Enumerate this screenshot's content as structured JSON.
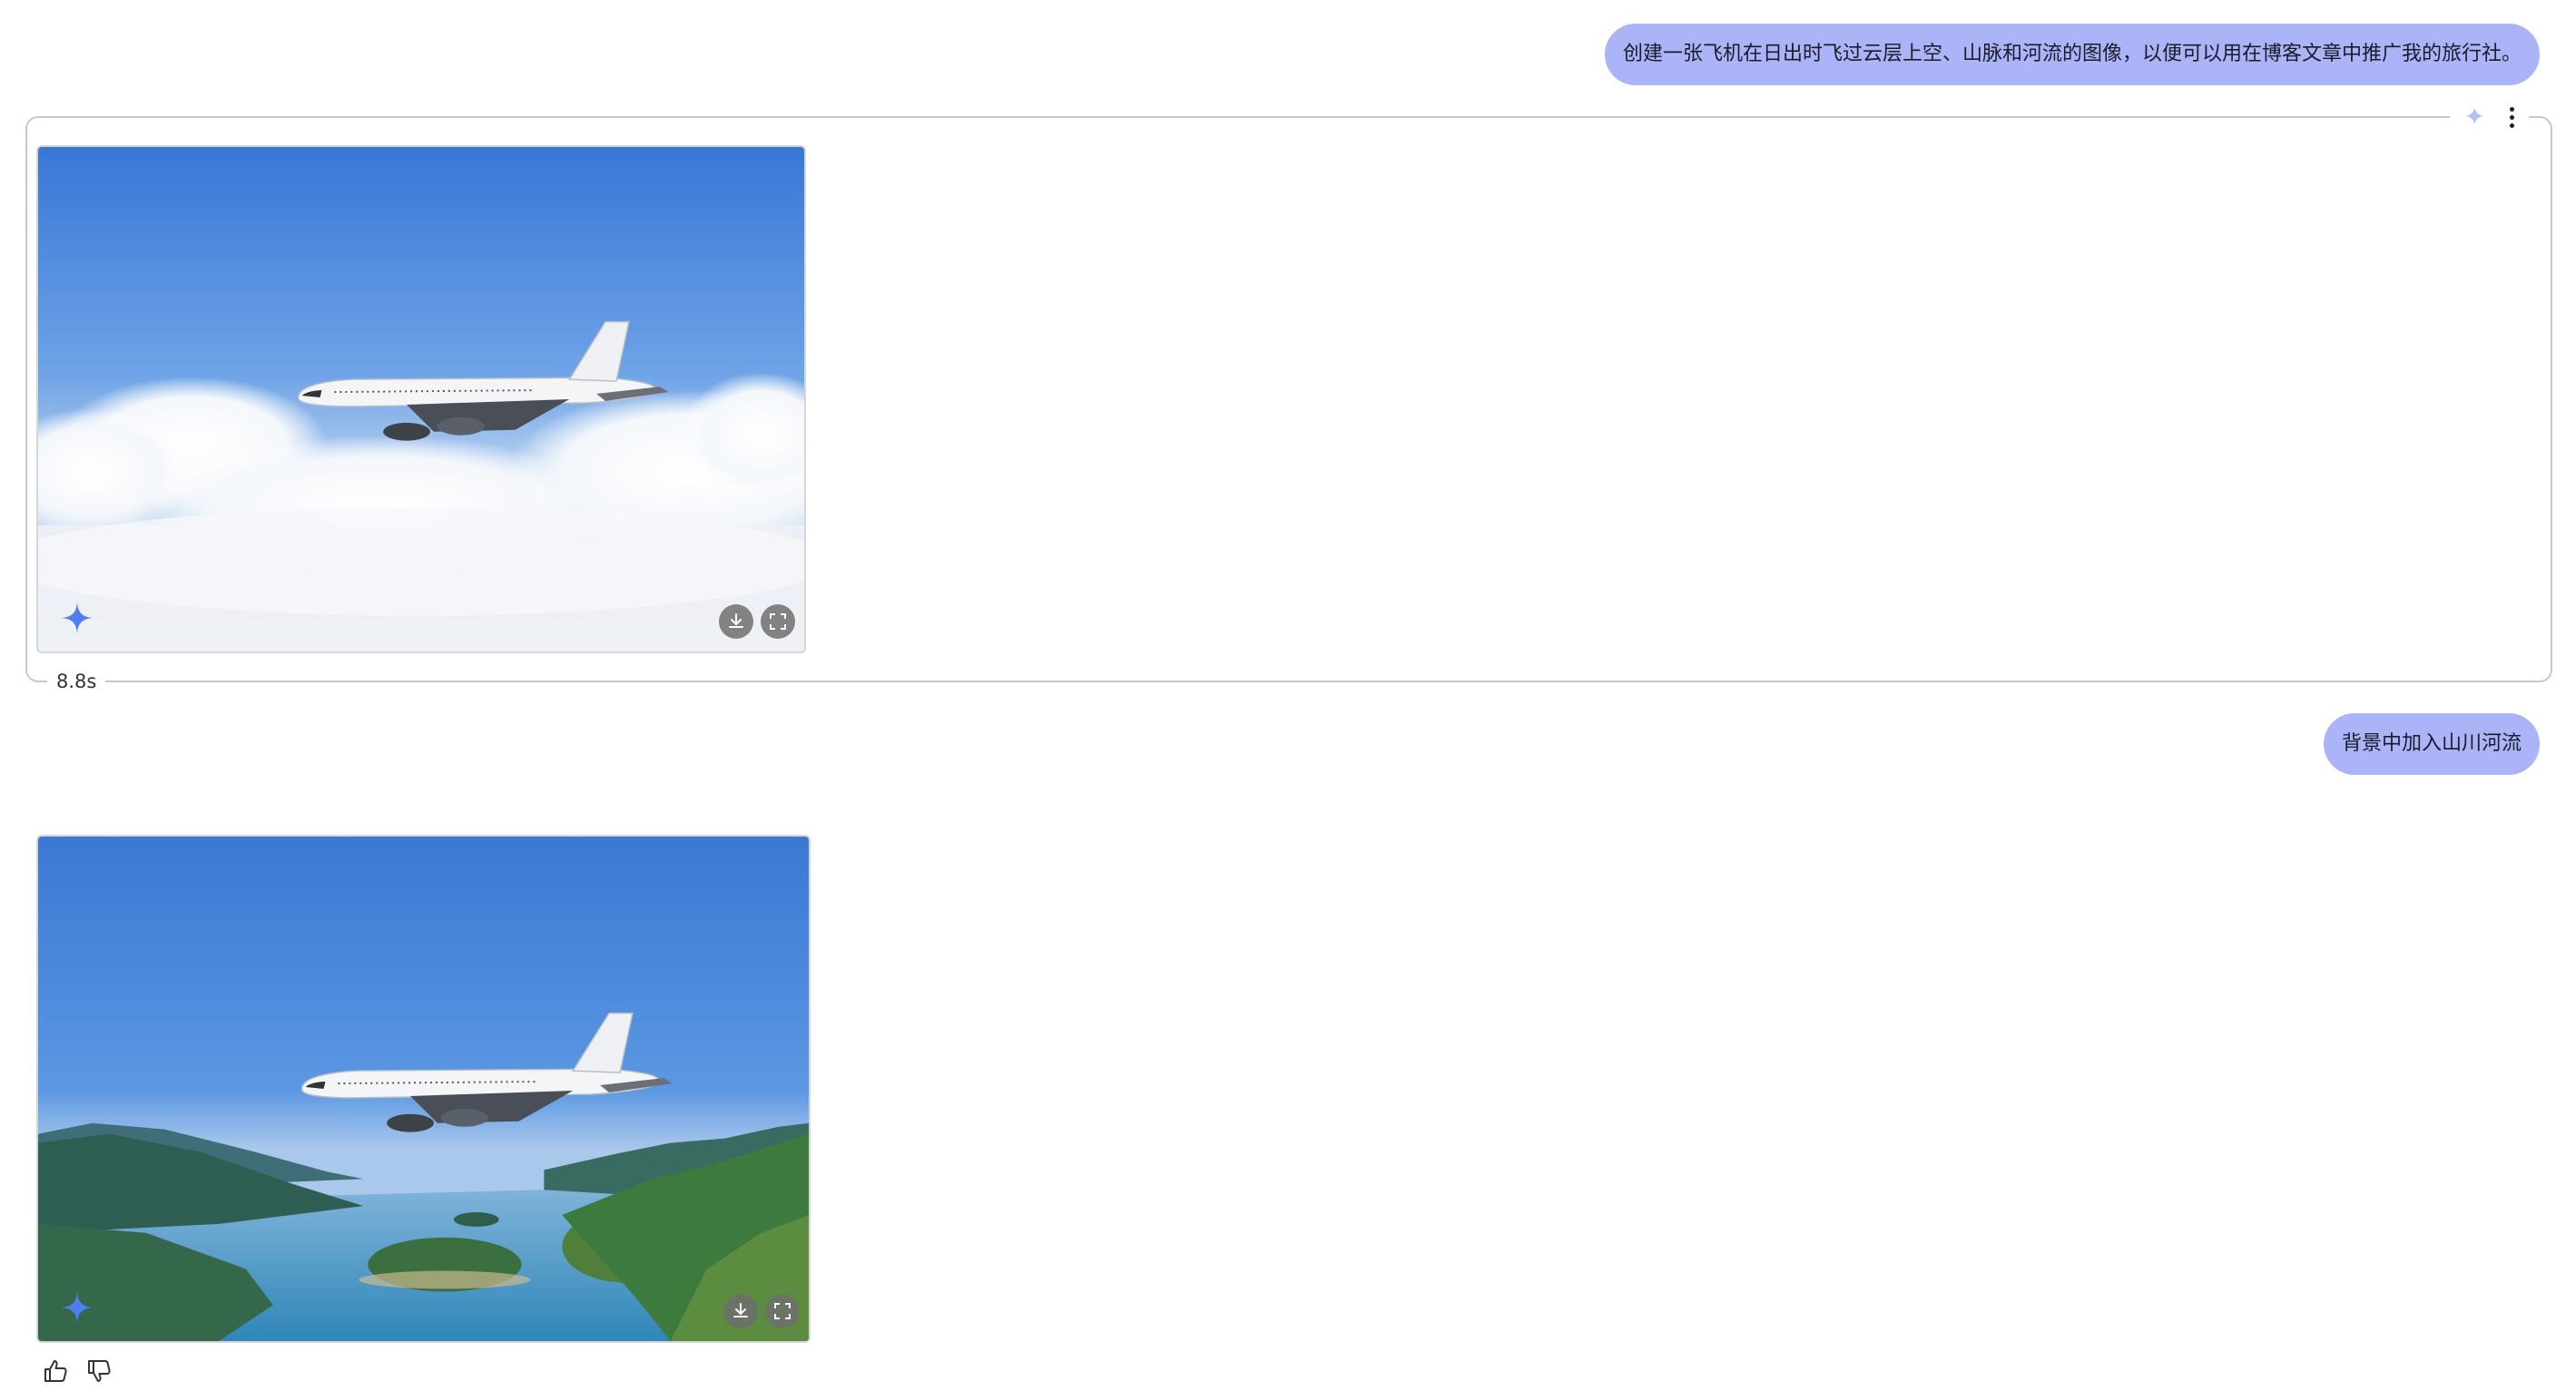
{
  "conversation": {
    "prompt_1": "创建一张飞机在日出时飞过云层上空、山脉和河流的图像，以便可以用在博客文章中推广我的旅行社。",
    "response_1": {
      "elapsed": "8.8s",
      "image_description_icons": [
        "sparkle-icon",
        "download-icon",
        "expand-icon"
      ]
    },
    "prompt_2": "背景中加入山川河流",
    "response_2": {
      "image_description_icons": [
        "sparkle-icon",
        "download-icon",
        "expand-icon",
        "thumbs-up-icon",
        "thumbs-down-icon"
      ]
    }
  },
  "colors": {
    "user_bubble": "#aab4f6",
    "sky_top": "#3a78d4",
    "sparkle_accent": "#4d7ff2"
  }
}
